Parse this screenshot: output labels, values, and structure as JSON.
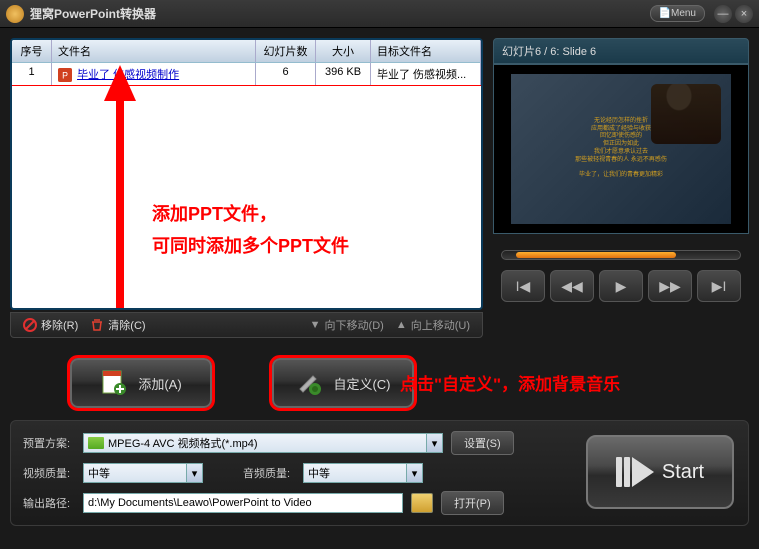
{
  "title": "狸窝PowerPoint转换器",
  "menu_label": "📄Menu",
  "table": {
    "headers": {
      "no": "序号",
      "name": "文件名",
      "slides": "幻灯片数",
      "size": "大小",
      "target": "目标文件名"
    },
    "row": {
      "no": "1",
      "name": "毕业了 伤感视频制作",
      "slides": "6",
      "size": "396 KB",
      "target": "毕业了 伤感视频..."
    }
  },
  "annotation1_l1": "添加PPT文件，",
  "annotation1_l2": "可同时添加多个PPT文件",
  "toolbar": {
    "remove": "移除(R)",
    "clear": "清除(C)",
    "movedown": "向下移动(D)",
    "moveup": "向上移动(U)"
  },
  "preview_header": "幻灯片6 / 6: Slide 6",
  "action": {
    "add": "添加(A)",
    "custom": "自定义(C)"
  },
  "annotation2": "点击\"自定义\"，添加背景音乐",
  "form": {
    "profile_label": "预置方案:",
    "profile_value": "MPEG-4 AVC 视频格式(*.mp4)",
    "settings": "设置(S)",
    "vq_label": "视频质量:",
    "vq_value": "中等",
    "aq_label": "音频质量:",
    "aq_value": "中等",
    "out_label": "输出路径:",
    "out_value": "d:\\My Documents\\Leawo\\PowerPoint to Video",
    "open": "打开(P)"
  },
  "start": "Start"
}
